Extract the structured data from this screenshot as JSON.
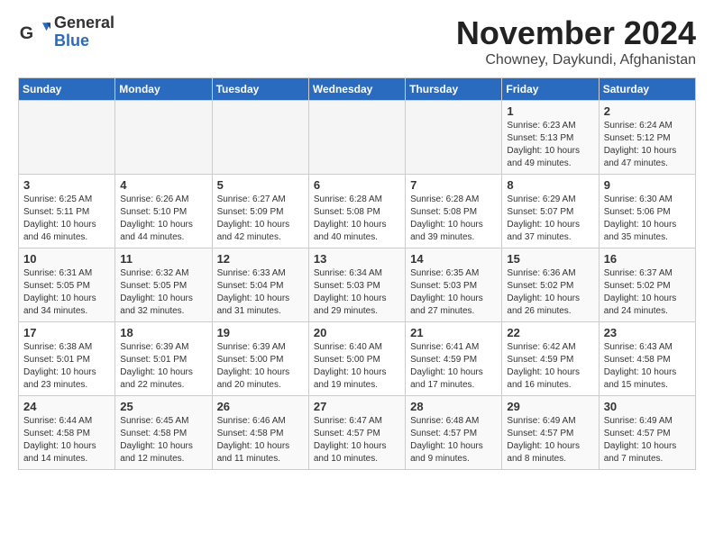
{
  "logo": {
    "general": "General",
    "blue": "Blue"
  },
  "header": {
    "month": "November 2024",
    "location": "Chowney, Daykundi, Afghanistan"
  },
  "weekdays": [
    "Sunday",
    "Monday",
    "Tuesday",
    "Wednesday",
    "Thursday",
    "Friday",
    "Saturday"
  ],
  "weeks": [
    [
      {
        "day": "",
        "info": ""
      },
      {
        "day": "",
        "info": ""
      },
      {
        "day": "",
        "info": ""
      },
      {
        "day": "",
        "info": ""
      },
      {
        "day": "",
        "info": ""
      },
      {
        "day": "1",
        "info": "Sunrise: 6:23 AM\nSunset: 5:13 PM\nDaylight: 10 hours\nand 49 minutes."
      },
      {
        "day": "2",
        "info": "Sunrise: 6:24 AM\nSunset: 5:12 PM\nDaylight: 10 hours\nand 47 minutes."
      }
    ],
    [
      {
        "day": "3",
        "info": "Sunrise: 6:25 AM\nSunset: 5:11 PM\nDaylight: 10 hours\nand 46 minutes."
      },
      {
        "day": "4",
        "info": "Sunrise: 6:26 AM\nSunset: 5:10 PM\nDaylight: 10 hours\nand 44 minutes."
      },
      {
        "day": "5",
        "info": "Sunrise: 6:27 AM\nSunset: 5:09 PM\nDaylight: 10 hours\nand 42 minutes."
      },
      {
        "day": "6",
        "info": "Sunrise: 6:28 AM\nSunset: 5:08 PM\nDaylight: 10 hours\nand 40 minutes."
      },
      {
        "day": "7",
        "info": "Sunrise: 6:28 AM\nSunset: 5:08 PM\nDaylight: 10 hours\nand 39 minutes."
      },
      {
        "day": "8",
        "info": "Sunrise: 6:29 AM\nSunset: 5:07 PM\nDaylight: 10 hours\nand 37 minutes."
      },
      {
        "day": "9",
        "info": "Sunrise: 6:30 AM\nSunset: 5:06 PM\nDaylight: 10 hours\nand 35 minutes."
      }
    ],
    [
      {
        "day": "10",
        "info": "Sunrise: 6:31 AM\nSunset: 5:05 PM\nDaylight: 10 hours\nand 34 minutes."
      },
      {
        "day": "11",
        "info": "Sunrise: 6:32 AM\nSunset: 5:05 PM\nDaylight: 10 hours\nand 32 minutes."
      },
      {
        "day": "12",
        "info": "Sunrise: 6:33 AM\nSunset: 5:04 PM\nDaylight: 10 hours\nand 31 minutes."
      },
      {
        "day": "13",
        "info": "Sunrise: 6:34 AM\nSunset: 5:03 PM\nDaylight: 10 hours\nand 29 minutes."
      },
      {
        "day": "14",
        "info": "Sunrise: 6:35 AM\nSunset: 5:03 PM\nDaylight: 10 hours\nand 27 minutes."
      },
      {
        "day": "15",
        "info": "Sunrise: 6:36 AM\nSunset: 5:02 PM\nDaylight: 10 hours\nand 26 minutes."
      },
      {
        "day": "16",
        "info": "Sunrise: 6:37 AM\nSunset: 5:02 PM\nDaylight: 10 hours\nand 24 minutes."
      }
    ],
    [
      {
        "day": "17",
        "info": "Sunrise: 6:38 AM\nSunset: 5:01 PM\nDaylight: 10 hours\nand 23 minutes."
      },
      {
        "day": "18",
        "info": "Sunrise: 6:39 AM\nSunset: 5:01 PM\nDaylight: 10 hours\nand 22 minutes."
      },
      {
        "day": "19",
        "info": "Sunrise: 6:39 AM\nSunset: 5:00 PM\nDaylight: 10 hours\nand 20 minutes."
      },
      {
        "day": "20",
        "info": "Sunrise: 6:40 AM\nSunset: 5:00 PM\nDaylight: 10 hours\nand 19 minutes."
      },
      {
        "day": "21",
        "info": "Sunrise: 6:41 AM\nSunset: 4:59 PM\nDaylight: 10 hours\nand 17 minutes."
      },
      {
        "day": "22",
        "info": "Sunrise: 6:42 AM\nSunset: 4:59 PM\nDaylight: 10 hours\nand 16 minutes."
      },
      {
        "day": "23",
        "info": "Sunrise: 6:43 AM\nSunset: 4:58 PM\nDaylight: 10 hours\nand 15 minutes."
      }
    ],
    [
      {
        "day": "24",
        "info": "Sunrise: 6:44 AM\nSunset: 4:58 PM\nDaylight: 10 hours\nand 14 minutes."
      },
      {
        "day": "25",
        "info": "Sunrise: 6:45 AM\nSunset: 4:58 PM\nDaylight: 10 hours\nand 12 minutes."
      },
      {
        "day": "26",
        "info": "Sunrise: 6:46 AM\nSunset: 4:58 PM\nDaylight: 10 hours\nand 11 minutes."
      },
      {
        "day": "27",
        "info": "Sunrise: 6:47 AM\nSunset: 4:57 PM\nDaylight: 10 hours\nand 10 minutes."
      },
      {
        "day": "28",
        "info": "Sunrise: 6:48 AM\nSunset: 4:57 PM\nDaylight: 10 hours\nand 9 minutes."
      },
      {
        "day": "29",
        "info": "Sunrise: 6:49 AM\nSunset: 4:57 PM\nDaylight: 10 hours\nand 8 minutes."
      },
      {
        "day": "30",
        "info": "Sunrise: 6:49 AM\nSunset: 4:57 PM\nDaylight: 10 hours\nand 7 minutes."
      }
    ]
  ]
}
